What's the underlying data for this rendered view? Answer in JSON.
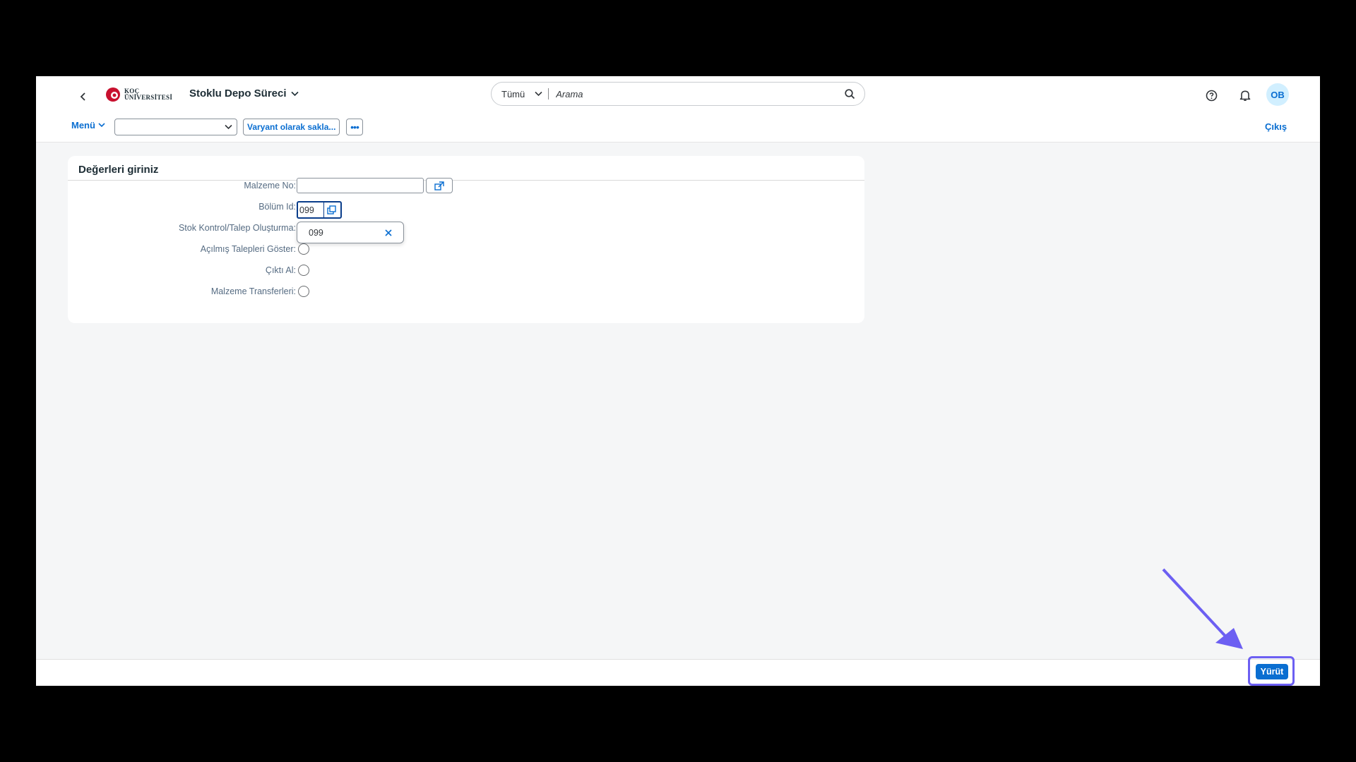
{
  "header": {
    "logo_line1": "KOÇ",
    "logo_line2": "ÜNİVERSİTESİ",
    "app_title": "Stoklu Depo Süreci",
    "search_scope": "Tümü",
    "search_placeholder": "Arama",
    "avatar_initials": "OB"
  },
  "toolbar": {
    "menu_label": "Menü",
    "variant_value": "",
    "save_variant_label": "Varyant olarak sakla...",
    "more_label": "•••",
    "exit_label": "Çıkış"
  },
  "form": {
    "title": "Değerleri giriniz",
    "fields": [
      {
        "label": "Malzeme No:",
        "value": ""
      },
      {
        "label": "Bölüm Id:",
        "value": "099"
      },
      {
        "label": "Stok Kontrol/Talep Oluşturma:"
      },
      {
        "label": "Açılmış Talepleri Göster:"
      },
      {
        "label": "Çıktı Al:"
      },
      {
        "label": "Malzeme Transferleri:"
      }
    ],
    "token_value": "099"
  },
  "footer": {
    "run_label": "Yürüt"
  },
  "colors": {
    "accent": "#0a6ed1",
    "annotation": "#6c5ff2"
  }
}
